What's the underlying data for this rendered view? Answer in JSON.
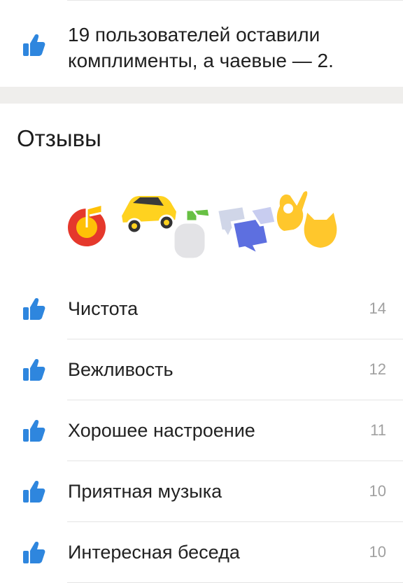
{
  "summary": {
    "line1": "19 пользователей оставили",
    "line2": "комплименты, а чаевые — 2."
  },
  "section": {
    "title": "Отзывы"
  },
  "stickers": [
    "music-note-icon",
    "taxi-car-icon",
    "spray-bottle-icon",
    "chat-bubbles-icon",
    "ok-hand-icon",
    "cat-icon"
  ],
  "reviews": [
    {
      "label": "Чистота",
      "count": "14"
    },
    {
      "label": "Вежливость",
      "count": "12"
    },
    {
      "label": "Хорошее настроение",
      "count": "11"
    },
    {
      "label": "Приятная музыка",
      "count": "10"
    },
    {
      "label": "Интересная беседа",
      "count": "10"
    }
  ],
  "colors": {
    "thumb": "#2e86de",
    "gap": "#efeeec",
    "count": "#a0a0a0"
  }
}
